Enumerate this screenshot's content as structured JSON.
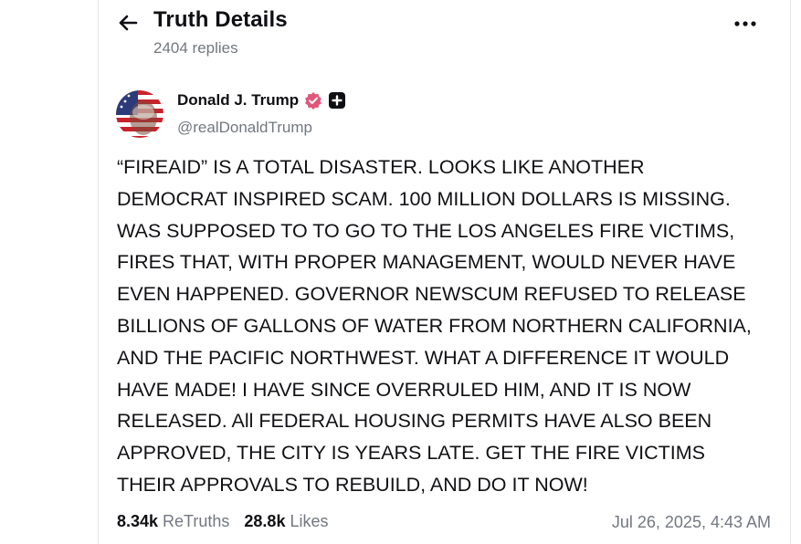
{
  "colors": {
    "accent_verified": "#e0567a",
    "muted_text": "#737780",
    "primary_text": "#0f0f14",
    "border": "#e6e7ea"
  },
  "header": {
    "back_icon": "arrow-left-icon",
    "title": "Truth Details",
    "replies": "2404 replies",
    "more_icon": "more-horizontal-icon"
  },
  "author": {
    "name": "Donald J. Trump",
    "handle": "@realDonaldTrump",
    "verified_icon": "verified-badge-icon",
    "plus_icon": "plus-badge-icon"
  },
  "post": {
    "text": "“FIREAID” IS A TOTAL DISASTER. LOOKS LIKE ANOTHER\nDEMOCRAT INSPIRED SCAM. 100 MILLION DOLLARS IS MISSING.\nWAS SUPPOSED TO TO GO TO THE LOS ANGELES FIRE VICTIMS,\nFIRES THAT, WITH PROPER MANAGEMENT, WOULD NEVER HAVE\nEVEN HAPPENED. GOVERNOR NEWSCUM REFUSED TO RELEASE\nBILLIONS OF GALLONS OF WATER FROM NORTHERN CALIFORNIA,\nAND THE PACIFIC NORTHWEST. WHAT A DIFFERENCE IT WOULD\nHAVE MADE! I HAVE SINCE OVERRULED HIM, AND IT IS NOW\nRELEASED. All FEDERAL HOUSING PERMITS HAVE ALSO BEEN\nAPPROVED, THE CITY IS YEARS LATE. GET THE FIRE VICTIMS\nTHEIR APPROVALS TO REBUILD, AND DO IT NOW!"
  },
  "stats": {
    "retruths_count": "8.34k",
    "retruths_label": "ReTruths",
    "likes_count": "28.8k",
    "likes_label": "Likes",
    "timestamp": "Jul 26, 2025, 4:43 AM"
  }
}
